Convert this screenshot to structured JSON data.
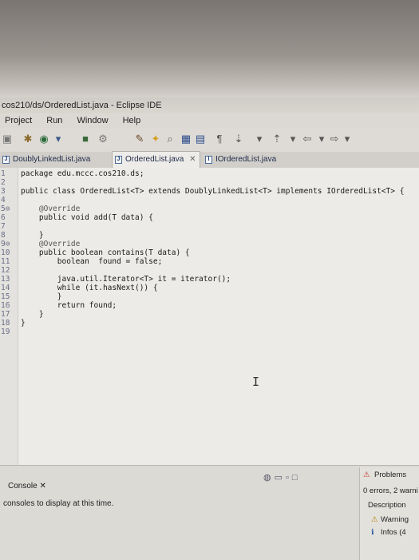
{
  "window": {
    "title": "cos210/ds/OrderedList.java - Eclipse IDE"
  },
  "menu": [
    "Project",
    "Run",
    "Window",
    "Help"
  ],
  "tabs": [
    {
      "label": "DoublyLinkedList.java",
      "active": false,
      "close": ""
    },
    {
      "label": "OrderedList.java",
      "active": true,
      "close": "✕"
    },
    {
      "label": "IOrderedList.java",
      "active": false,
      "close": ""
    }
  ],
  "editor": {
    "line_numbers": [
      "1",
      "2",
      "3",
      "4",
      "5⊖",
      "6",
      "7",
      "8",
      "9⊖",
      "10",
      "11",
      "12",
      "13",
      "14",
      "15",
      "16",
      "17",
      "18",
      "19"
    ],
    "lines": [
      "package edu.mccc.cos210.ds;",
      "",
      "public class OrderedList<T> extends DoublyLinkedList<T> implements IOrderedList<T> {",
      "",
      "    @Override",
      "    public void add(T data) {",
      "",
      "    }",
      "    @Override",
      "    public boolean contains(T data) {",
      "        boolean  found = false;",
      "",
      "        java.util.Iterator<T> it = iterator();",
      "        while (it.hasNext()) {",
      "        }",
      "        return found;",
      "    }",
      "}",
      ""
    ],
    "cursor_glyph": "I"
  },
  "console": {
    "tab_label": "Console ✕",
    "message": "consoles to display at this time."
  },
  "problems": {
    "tab_label": "Problems",
    "summary": "0 errors, 2 warni",
    "column": "Description",
    "items": [
      "Warning",
      "Infos (4"
    ]
  }
}
